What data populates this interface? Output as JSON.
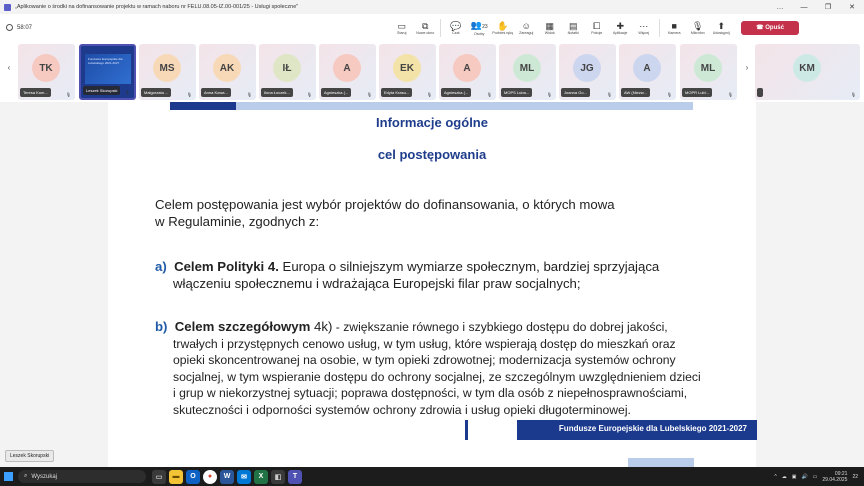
{
  "window": {
    "title": "„Aplikowanie o środki na dofinansowanie projektu w ramach naboru nr FELU.08.05-IZ.00-001/25 - Usługi społeczne\"",
    "controls": [
      "…",
      "—",
      "❐",
      "✕"
    ]
  },
  "toolbar": {
    "timer": "58:07",
    "items": [
      {
        "label": "Staruj",
        "icon": "▭"
      },
      {
        "label": "Nowe okno",
        "icon": "⧉"
      },
      {
        "label": "Czat",
        "icon": "💬"
      },
      {
        "label": "Osoby",
        "icon": "👥",
        "count": "23"
      },
      {
        "label": "Podnieś rękę",
        "icon": "✋"
      },
      {
        "label": "Zareaguj",
        "icon": "☺"
      },
      {
        "label": "Widok",
        "icon": "▦"
      },
      {
        "label": "Notatki",
        "icon": "▤"
      },
      {
        "label": "Pokoje",
        "icon": "⧠"
      },
      {
        "label": "Aplikacje",
        "icon": "✚"
      },
      {
        "label": "Więcej",
        "icon": "⋯"
      }
    ],
    "media": [
      {
        "label": "Kamera",
        "icon": "■"
      },
      {
        "label": "Mikrofon",
        "icon": "🎙"
      },
      {
        "label": "Udostępnij",
        "icon": "⬆"
      }
    ],
    "leave_label": "Opuść"
  },
  "participants": [
    {
      "initials": "TK",
      "name": "Teresa Kom...",
      "color": "#f6c9c1"
    },
    {
      "initials": "",
      "name": "Leszek Skorupski",
      "screen": true,
      "thumb": "Fundusze Europejskie dla Lubelskiego 2021-2027"
    },
    {
      "initials": "MS",
      "name": "Małgorzata ...",
      "color": "#f7d9b8"
    },
    {
      "initials": "AK",
      "name": "Anna Kowa...",
      "color": "#f7d9b8"
    },
    {
      "initials": "IŁ",
      "name": "Ilona Łoczek...",
      "color": "#dfe6c5"
    },
    {
      "initials": "A",
      "name": "Agnieszka (...",
      "color": "#f6c9c1"
    },
    {
      "initials": "EK",
      "name": "Edyta Krasu...",
      "color": "#f3e3a8"
    },
    {
      "initials": "A",
      "name": "Agnieszka (...",
      "color": "#f6c9c1"
    },
    {
      "initials": "ML",
      "name": "MOPS Luba...",
      "color": "#cde9d6"
    },
    {
      "initials": "JG",
      "name": "Joanna Go...",
      "color": "#cdd6ef"
    },
    {
      "initials": "A",
      "name": "AW (Niezw...",
      "color": "#cdd6ef"
    },
    {
      "initials": "ML",
      "name": "MOPR Lubl...",
      "color": "#cde9d6"
    },
    {
      "initials": "KM",
      "name": "",
      "color": "#cde9e6"
    }
  ],
  "slide": {
    "heading1": "Informacje ogólne",
    "heading2": "cel postępowania",
    "intro_l1": "Celem postępowania jest wybór projektów do dofinansowania, o których mowa",
    "intro_l2": "w Regulaminie, zgodnych z:",
    "a_label": "a)",
    "a_bold": "Celem Polityki 4.",
    "a_rest": " Europa o silniejszym wymiarze społecznym, bardziej sprzyjająca",
    "a_l2": "włączeniu społecznemu i wdrażająca Europejski filar praw socjalnych;",
    "b_label": "b)",
    "b_bold": "Celem szczegółowym",
    "b_code": " 4k)",
    "b_rest": " - zwiększanie równego i szybkiego dostępu do dobrej jakości,",
    "b_lines": [
      "trwałych i przystępnych cenowo usług, w tym usług, które wspierają dostęp do mieszkań oraz",
      "opieki skoncentrowanej na osobie, w tym opieki zdrowotnej; modernizacja systemów ochrony",
      "socjalnej, w tym wspieranie dostępu do ochrony socjalnej, ze szczególnym uwzględnieniem dzieci",
      "i grup w niekorzystnej sytuacji; poprawa dostępności, w tym dla osób z niepełnosprawnościami,",
      "skuteczności i odporności systemów ochrony zdrowia i usług opieki długoterminowej."
    ],
    "footer": "Fundusze Europejskie dla Lubelskiego 2021-2027"
  },
  "presenter_label": "Leszek Skorupski",
  "taskbar": {
    "search_placeholder": "Wyszukaj",
    "time": "09:21",
    "date": "29.04.2025",
    "notif": "22"
  }
}
